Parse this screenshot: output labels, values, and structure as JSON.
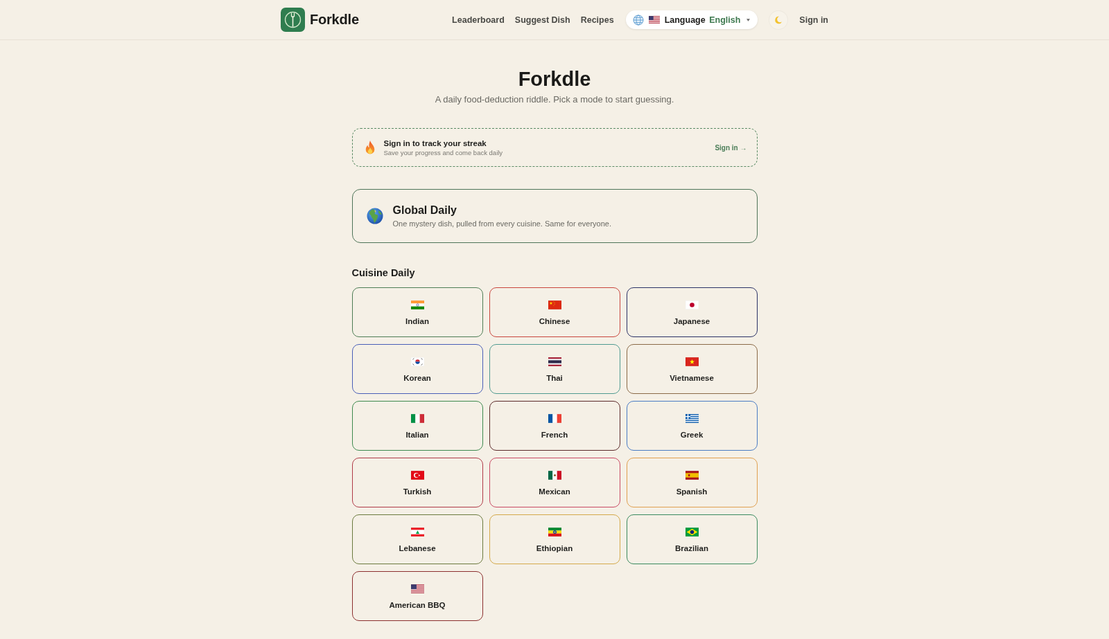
{
  "header": {
    "brand": "Forkdle",
    "nav": [
      "Leaderboard",
      "Suggest Dish",
      "Recipes"
    ],
    "language": {
      "kind": "usa",
      "label": "Language",
      "value": "English"
    },
    "sign_in": "Sign in"
  },
  "hero": {
    "title": "Forkdle",
    "subtitle": "A daily food-deduction riddle. Pick a mode to start guessing."
  },
  "streak_banner": {
    "title": "Sign in to track your streak",
    "subtitle": "Save your progress and come back daily",
    "action": "Sign in →"
  },
  "global_daily": {
    "title": "Global Daily",
    "description": "One mystery dish, pulled from every cuisine. Same for everyone."
  },
  "cuisine_daily": {
    "heading": "Cuisine Daily",
    "items": [
      {
        "name": "Indian",
        "kind": "india",
        "color": "#4e7d55"
      },
      {
        "name": "Chinese",
        "kind": "china",
        "color": "#c9463d"
      },
      {
        "name": "Japanese",
        "kind": "japan",
        "color": "#2b3266"
      },
      {
        "name": "Korean",
        "kind": "korea",
        "color": "#4a5fb8"
      },
      {
        "name": "Thai",
        "kind": "thailand",
        "color": "#4f9a90"
      },
      {
        "name": "Vietnamese",
        "kind": "vietnam",
        "color": "#8b6a47"
      },
      {
        "name": "Italian",
        "kind": "italy",
        "color": "#3e8a4f"
      },
      {
        "name": "French",
        "kind": "france",
        "color": "#5c2a2a"
      },
      {
        "name": "Greek",
        "kind": "greece",
        "color": "#4a7cc4"
      },
      {
        "name": "Turkish",
        "kind": "turkey",
        "color": "#b03a48"
      },
      {
        "name": "Mexican",
        "kind": "mexico",
        "color": "#c94a64"
      },
      {
        "name": "Spanish",
        "kind": "spain",
        "color": "#e0a050"
      },
      {
        "name": "Lebanese",
        "kind": "lebanon",
        "color": "#6b7a3e"
      },
      {
        "name": "Ethiopian",
        "kind": "ethiopia",
        "color": "#d4a94a"
      },
      {
        "name": "Brazilian",
        "kind": "brazil",
        "color": "#3a8a5e"
      },
      {
        "name": "American BBQ",
        "kind": "usa",
        "color": "#8c2f2f"
      }
    ]
  }
}
